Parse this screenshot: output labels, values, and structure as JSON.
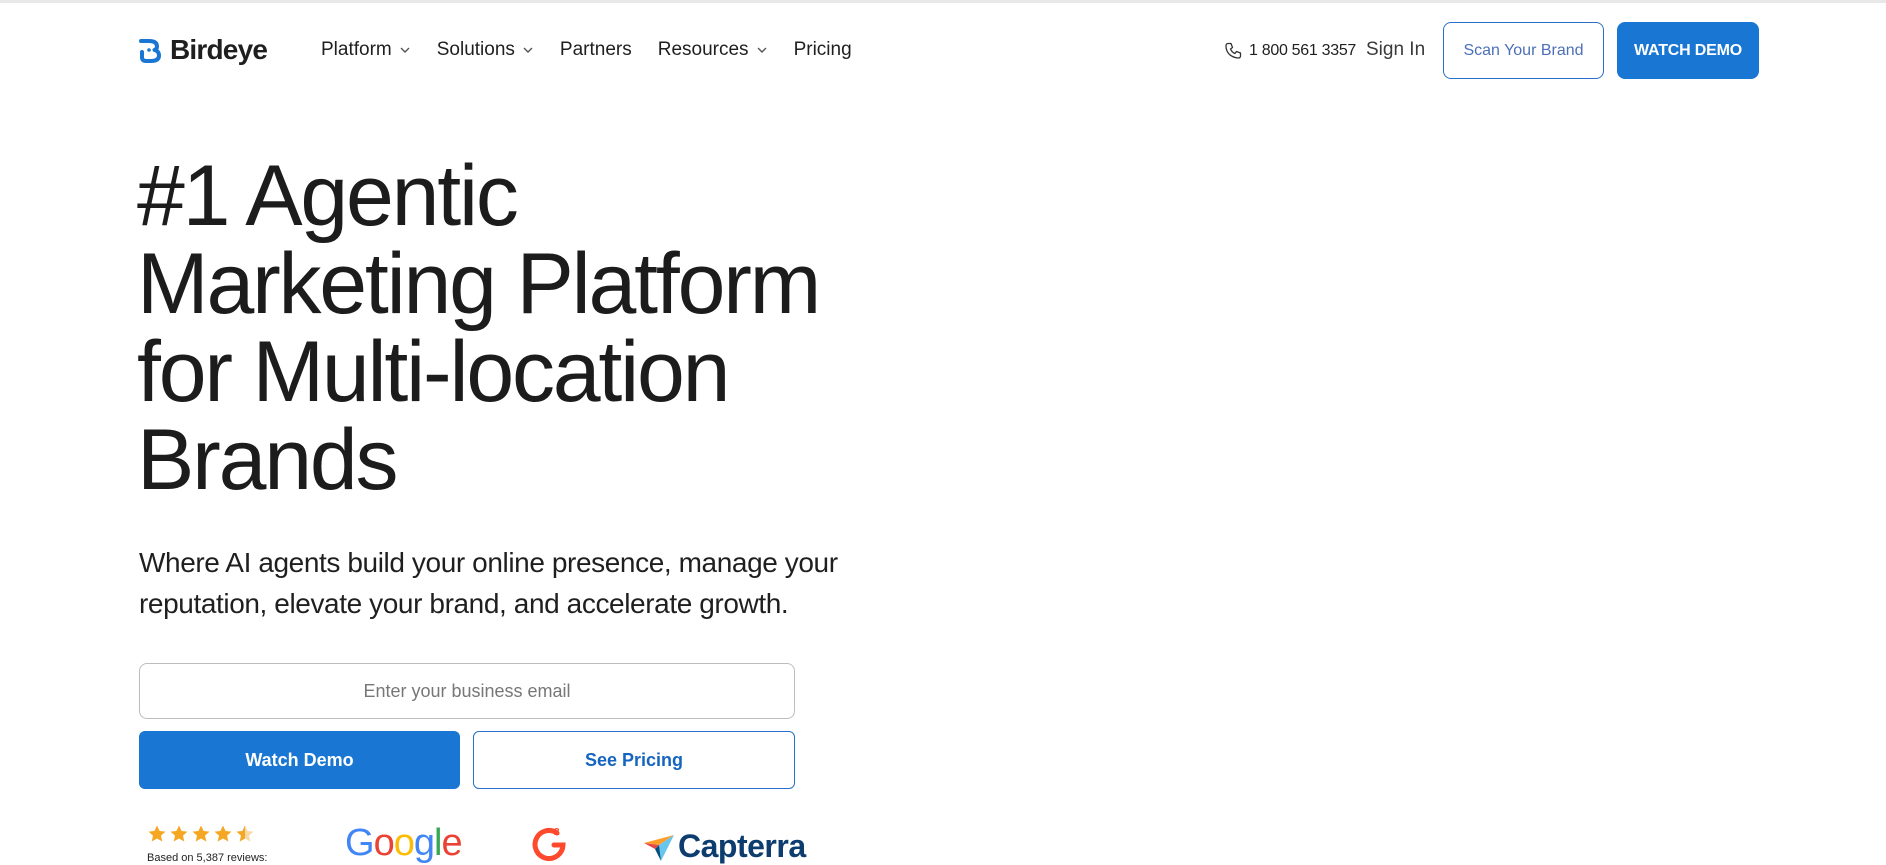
{
  "brand": {
    "name": "Birdeye",
    "accent": "#1976d2"
  },
  "nav": {
    "items": [
      {
        "label": "Platform",
        "has_dropdown": true
      },
      {
        "label": "Solutions",
        "has_dropdown": true
      },
      {
        "label": "Partners",
        "has_dropdown": false
      },
      {
        "label": "Resources",
        "has_dropdown": true
      },
      {
        "label": "Pricing",
        "has_dropdown": false
      }
    ],
    "phone": "1 800 561 3357",
    "sign_in": "Sign In",
    "scan_brand": "Scan Your Brand",
    "watch_demo": "WATCH DEMO"
  },
  "hero": {
    "title_lines": [
      "#1 Agentic",
      "Marketing Platform",
      "for Multi-location",
      "Brands"
    ],
    "subtitle": "Where AI agents build your online presence, manage your reputation, elevate your brand, and accelerate growth.",
    "email_placeholder": "Enter your business email",
    "watch_demo": "Watch Demo",
    "see_pricing": "See Pricing"
  },
  "ratings": {
    "stars": 4.5,
    "reviews_text": "Based on 5,387 reviews:",
    "platforms": [
      "Google",
      "G2",
      "Capterra"
    ]
  }
}
